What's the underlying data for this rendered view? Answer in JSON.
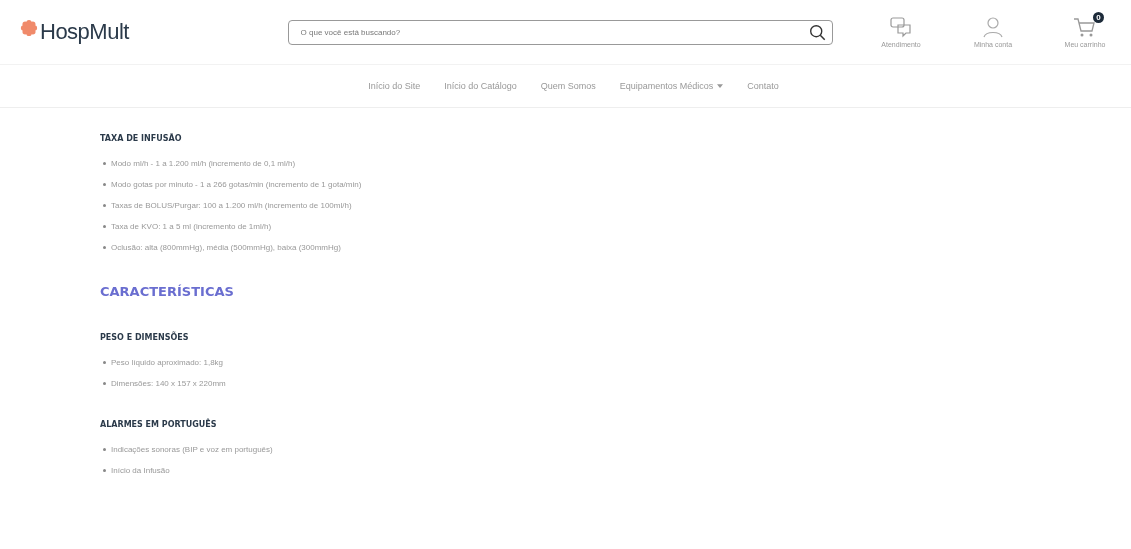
{
  "header": {
    "logo": "HospMult",
    "search": {
      "placeholder": "O que você está buscando?"
    },
    "actions": [
      {
        "kind": "chat",
        "label": "Atendimento"
      },
      {
        "kind": "user",
        "label": "Minha conta"
      },
      {
        "kind": "cart",
        "label": "Meu carrinho",
        "badge": "0"
      }
    ]
  },
  "nav": [
    {
      "label": "Início do Site",
      "has_dropdown": false
    },
    {
      "label": "Início do Catálogo",
      "has_dropdown": false
    },
    {
      "label": "Quem Somos",
      "has_dropdown": false
    },
    {
      "label": "Equipamentos Médicos",
      "has_dropdown": true
    },
    {
      "label": "Contato",
      "has_dropdown": false
    }
  ],
  "content": [
    {
      "kind": "subheading",
      "text": "TAXA DE INFUSÃO",
      "items": [
        "Modo ml/h - 1 a 1.200 ml/h (incremento de 0,1 ml/h)",
        "Modo gotas por minuto - 1 a 266 gotas/min (incremento de 1 gota/min)",
        "Taxas de BOLUS/Purgar: 100 a 1.200 ml/h (incremento de 100ml/h)",
        "Taxa de KVO: 1 a 5 ml (incremento de 1ml/h)",
        "Oclusão: alta (800mmHg), média (500mmHg), baixa (300mmHg)"
      ]
    },
    {
      "kind": "heading",
      "text": "CARACTERÍSTICAS"
    },
    {
      "kind": "subheading",
      "text": "PESO E DIMENSÕES",
      "items": [
        "Peso líquido aproximado: 1,8kg",
        "Dimensões: 140 x 157 x 220mm"
      ]
    },
    {
      "kind": "subheading",
      "text": "ALARMES EM PORTUGUÊS",
      "items": [
        "Indicações sonoras (BIP e voz em português)",
        "Início da Infusão"
      ]
    }
  ]
}
